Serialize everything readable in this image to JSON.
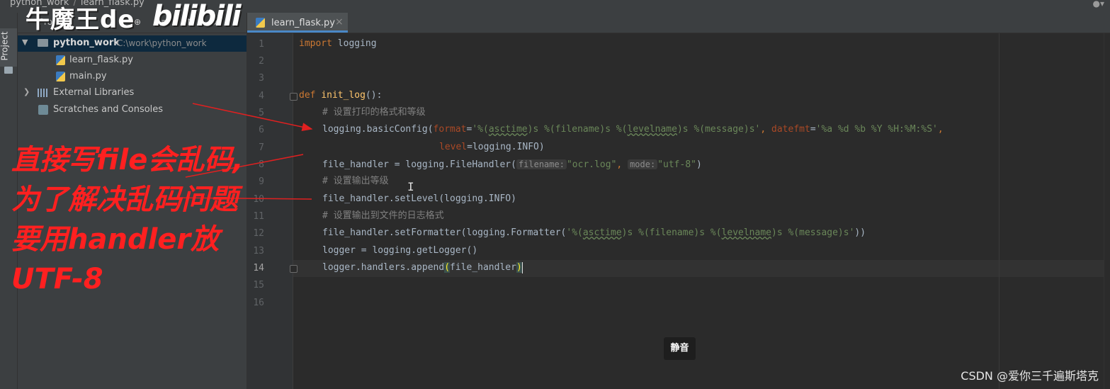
{
  "breadcrumb": {
    "project": "python_work",
    "file": "learn_flask.py"
  },
  "watermark": {
    "text": "牛魔王de",
    "bili": "bilibili"
  },
  "toolwindow": {
    "project_tab": "Project"
  },
  "project_panel": {
    "header_label": "Project",
    "tree": [
      {
        "label": "python_work",
        "path": "C:\\work\\python_work",
        "type": "folder",
        "expanded": true,
        "selected": true
      },
      {
        "label": "learn_flask.py",
        "type": "python-file"
      },
      {
        "label": "main.py",
        "type": "python-file"
      },
      {
        "label": "External Libraries",
        "type": "libraries",
        "expanded": false
      },
      {
        "label": "Scratches and Consoles",
        "type": "scratches"
      }
    ]
  },
  "annotation": {
    "lines": [
      "直接写file会乱码,",
      "为了解决乱码问题",
      "要用handler放",
      "UTF-8"
    ],
    "color": "#ff2020"
  },
  "editor": {
    "tab": {
      "label": "learn_flask.py",
      "close": "×"
    },
    "current_line": 14,
    "line_numbers": [
      "1",
      "2",
      "3",
      "4",
      "5",
      "6",
      "7",
      "8",
      "9",
      "10",
      "11",
      "12",
      "13",
      "14",
      "15",
      "16"
    ],
    "code": {
      "l1_import": "import",
      "l1_mod": " logging",
      "l4_def": "def ",
      "l4_name": "init_log",
      "l4_rest": "():",
      "l5_comment": "# 设置打印的格式和等级",
      "l6_a": "logging.basicConfig(",
      "l6_p1": "format",
      "l6_eq1": "=",
      "l6_s1a": "'%(",
      "l6_s1b": "asctime",
      "l6_s1c": ")s %(filename)s %(",
      "l6_s1d": "levelname",
      "l6_s1e": ")s %(message)s'",
      "l6_comma": ", ",
      "l6_p2": "datefmt",
      "l6_eq2": "=",
      "l6_s2": "'%a %d %b %Y %H:%M:%S'",
      "l6_end": ",",
      "l7_p": "level",
      "l7_rest": "=logging.INFO)",
      "l8_a": "file_handler = logging.FileHandler(",
      "l8_hint1": "filename:",
      "l8_s1": "\"ocr.log\"",
      "l8_comma": ", ",
      "l8_hint2": "mode:",
      "l8_s2": "\"utf-8\"",
      "l8_end": ")",
      "l9_comment": "# 设置输出等级",
      "l10": "file_handler.setLevel(logging.INFO)",
      "l11_comment": "# 设置输出到文件的日志格式",
      "l12_a": "file_handler.setFormatter(logging.Formatter(",
      "l12_s1a": "'%(",
      "l12_s1b": "asctime",
      "l12_s1c": ")s %(filename)s %(",
      "l12_s1d": "levelname",
      "l12_s1e": ")s %(message)s'",
      "l12_end": "))",
      "l13": "logger = logging.getLogger()",
      "l14_a": "logger.handlers.append",
      "l14_open": "(",
      "l14_mid": "file_handler",
      "l14_close": ")"
    }
  },
  "toast": {
    "text": "静音"
  },
  "credit": {
    "text": "CSDN @爱你三千遍斯塔克"
  },
  "colors": {
    "keyword": "#cc7832",
    "function": "#ffc66d",
    "string": "#6a8759",
    "comment": "#808080",
    "param": "#aa4926",
    "arrow": "#e02020"
  }
}
